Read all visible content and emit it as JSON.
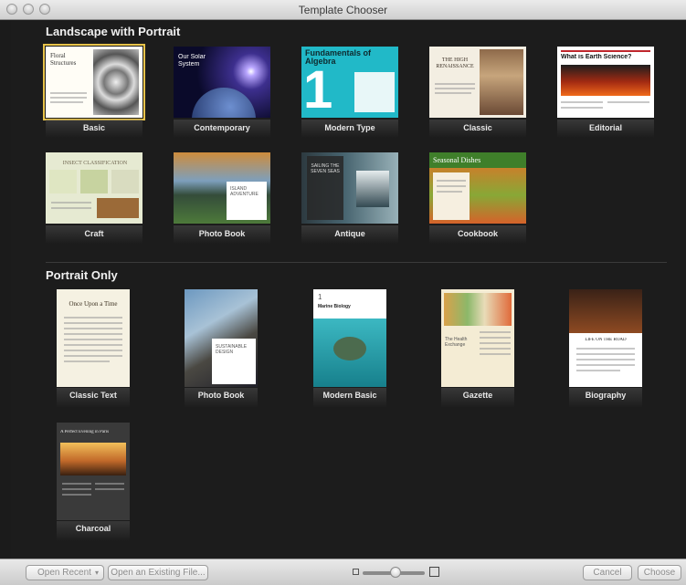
{
  "window": {
    "title": "Template Chooser"
  },
  "sections": {
    "landscape": {
      "title": "Landscape with Portrait",
      "templates": [
        {
          "name": "Basic",
          "cover_title": "Floral Structures"
        },
        {
          "name": "Contemporary",
          "cover_title": "Our Solar System"
        },
        {
          "name": "Modern Type",
          "cover_title": "Fundamentals of Algebra",
          "cover_numeral": "1"
        },
        {
          "name": "Classic",
          "cover_title": "THE HIGH RENAISSANCE"
        },
        {
          "name": "Editorial",
          "cover_title": "What is Earth Science?"
        },
        {
          "name": "Craft",
          "cover_title": "INSECT CLASSIFICATION"
        },
        {
          "name": "Photo Book",
          "cover_title": "ISLAND ADVENTURE"
        },
        {
          "name": "Antique",
          "cover_title": "SAILING THE SEVEN SEAS"
        },
        {
          "name": "Cookbook",
          "cover_title": "Seasonal Dishes"
        }
      ]
    },
    "portrait": {
      "title": "Portrait Only",
      "templates": [
        {
          "name": "Classic Text",
          "cover_title": "Once Upon a Time"
        },
        {
          "name": "Photo Book",
          "cover_title": "SUSTAINABLE DESIGN"
        },
        {
          "name": "Modern Basic",
          "cover_title": "Marine Biology"
        },
        {
          "name": "Gazette",
          "cover_title": "The Health Exchange"
        },
        {
          "name": "Biography",
          "cover_title": "LIFE ON THE ROAD"
        },
        {
          "name": "Charcoal",
          "cover_title": "A Perfect Evening in Paris"
        }
      ]
    }
  },
  "selected_template": "Basic",
  "footer": {
    "open_recent": "Open Recent",
    "open_existing": "Open an Existing File...",
    "cancel": "Cancel",
    "choose": "Choose",
    "zoom_level": 0.45
  }
}
